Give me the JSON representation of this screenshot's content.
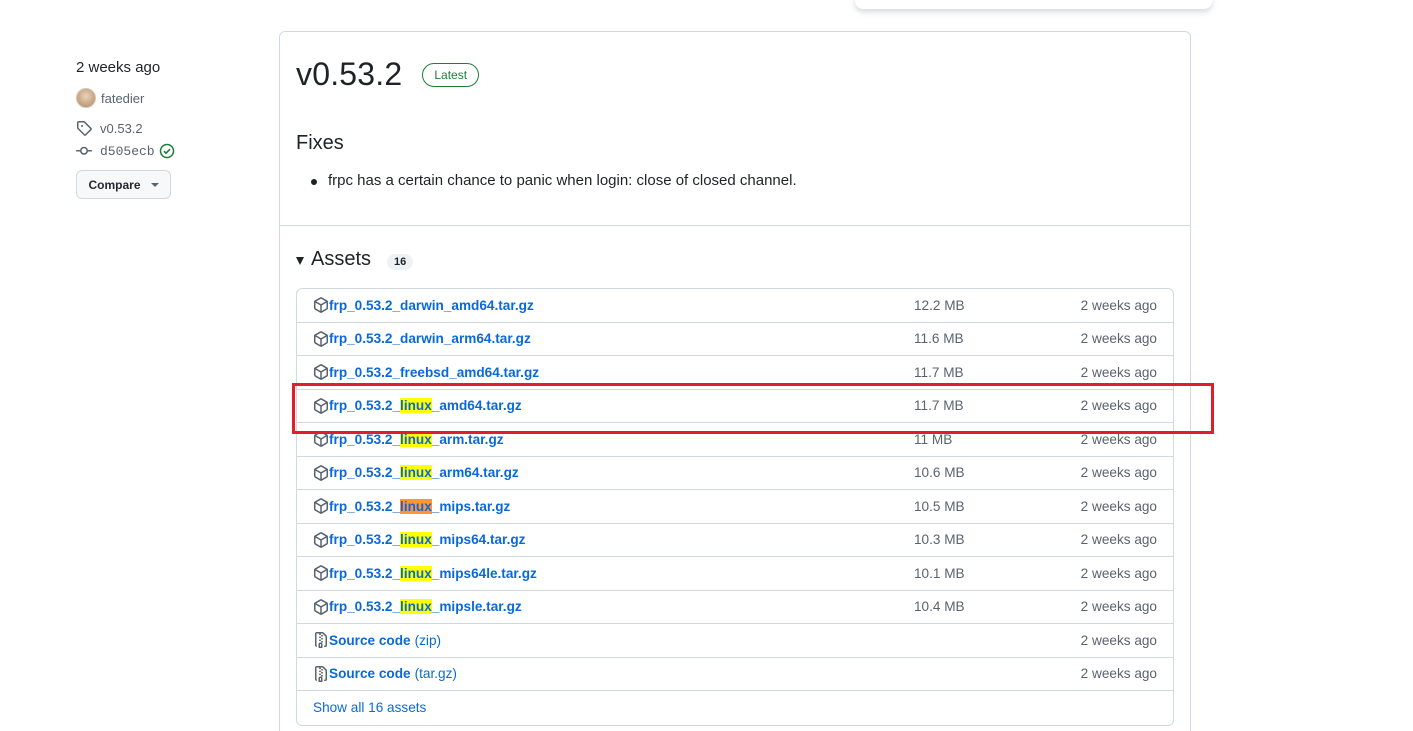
{
  "sidebar": {
    "time": "2 weeks ago",
    "author": "fatedier",
    "tag": "v0.53.2",
    "commit": "d505ecb",
    "compare_label": "Compare"
  },
  "release": {
    "title": "v0.53.2",
    "latest_label": "Latest",
    "fixes_heading": "Fixes",
    "fixes": [
      "frpc has a certain chance to panic when login: close of closed channel."
    ],
    "assets_heading": "Assets",
    "assets_count": "16",
    "assets": [
      {
        "pre": "frp_0.53.2_darwin_amd64.tar.gz",
        "hl": "",
        "post": "",
        "size": "12.2 MB",
        "date": "2 weeks ago",
        "kind": "package"
      },
      {
        "pre": "frp_0.53.2_darwin_arm64.tar.gz",
        "hl": "",
        "post": "",
        "size": "11.6 MB",
        "date": "2 weeks ago",
        "kind": "package"
      },
      {
        "pre": "frp_0.53.2_freebsd_amd64.tar.gz",
        "hl": "",
        "post": "",
        "size": "11.7 MB",
        "date": "2 weeks ago",
        "kind": "package"
      },
      {
        "pre": "frp_0.53.2_",
        "hl": "linux",
        "post": "_amd64.tar.gz",
        "size": "11.7 MB",
        "date": "2 weeks ago",
        "kind": "package"
      },
      {
        "pre": "frp_0.53.2_",
        "hl": "linux",
        "post": "_arm.tar.gz",
        "size": "11 MB",
        "date": "2 weeks ago",
        "kind": "package"
      },
      {
        "pre": "frp_0.53.2_",
        "hl": "linux",
        "post": "_arm64.tar.gz",
        "size": "10.6 MB",
        "date": "2 weeks ago",
        "kind": "package"
      },
      {
        "pre": "frp_0.53.2_",
        "hl": "linux",
        "post": "_mips.tar.gz",
        "size": "10.5 MB",
        "date": "2 weeks ago",
        "kind": "package",
        "active": true
      },
      {
        "pre": "frp_0.53.2_",
        "hl": "linux",
        "post": "_mips64.tar.gz",
        "size": "10.3 MB",
        "date": "2 weeks ago",
        "kind": "package"
      },
      {
        "pre": "frp_0.53.2_",
        "hl": "linux",
        "post": "_mips64le.tar.gz",
        "size": "10.1 MB",
        "date": "2 weeks ago",
        "kind": "package"
      },
      {
        "pre": "frp_0.53.2_",
        "hl": "linux",
        "post": "_mipsle.tar.gz",
        "size": "10.4 MB",
        "date": "2 weeks ago",
        "kind": "package"
      },
      {
        "pre": "Source code",
        "hl": "",
        "post": "",
        "suffix": "(zip)",
        "size": "",
        "date": "2 weeks ago",
        "kind": "zip"
      },
      {
        "pre": "Source code",
        "hl": "",
        "post": "",
        "suffix": "(tar.gz)",
        "size": "",
        "date": "2 weeks ago",
        "kind": "zip"
      }
    ],
    "show_all": "Show all 16 assets"
  },
  "colors": {
    "link": "#0969da",
    "muted": "#59636e",
    "search_highlight": "#ffff00",
    "active_highlight": "#ff9632",
    "annotation_box": "#e11d2e",
    "latest_green": "#1a7f37"
  }
}
